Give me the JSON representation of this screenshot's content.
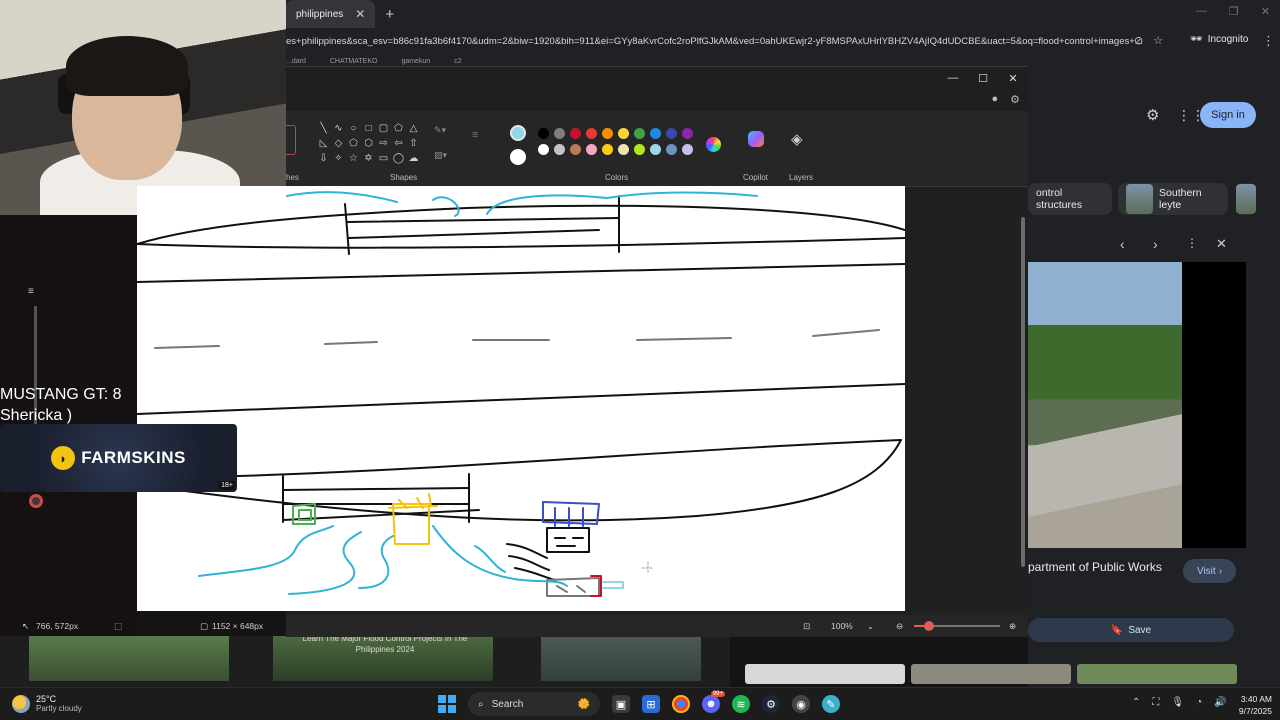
{
  "browser": {
    "tab_title": "philippines",
    "address": "es+philippines&sca_esv=b86c91fa3b6f4170&udm=2&biw=1920&bih=911&ei=GYy8aKvrCofc2roPlfGJkAM&ved=0ahUKEwjr2-yF8MSPAxUHrlYBHZV4AjIQ4dUDCBE&uact=5&oq=flood+control+images+...",
    "incognito_label": "Incognito",
    "bookmarks": [
      "...dard",
      "CHATMATEKO",
      "gamekun",
      "c2"
    ]
  },
  "google": {
    "signin": "Sign in",
    "chips": [
      "ontrol structures",
      "Southern leyte"
    ],
    "source": "partment of Public Works",
    "visit": "Visit",
    "save": "Save"
  },
  "stream": {
    "overlay_line1": "MUSTANG GT: 8",
    "overlay_line2": "Shericka )",
    "sponsor": "FARMSKINS",
    "sponsor_badge": "18+"
  },
  "paint": {
    "group_brushes": "hes",
    "group_shapes": "Shapes",
    "group_colors": "Colors",
    "group_copilot": "Copilot",
    "group_layers": "Layers",
    "cursor_pos": "766, 572px",
    "canvas_size": "1152 × 648px",
    "zoom": "100%",
    "active_color": "#8fd6e6",
    "palette_row1": [
      "#000000",
      "#7f7f7f",
      "#c8102e",
      "#e53935",
      "#fb8c00",
      "#fdd835",
      "#43a047",
      "#1e88e5",
      "#3949ab",
      "#8e24aa"
    ],
    "palette_row2": [
      "#ffffff",
      "#c3c3c3",
      "#b97a57",
      "#f8a5c2",
      "#ffc90e",
      "#efe4b0",
      "#b5e61d",
      "#99d9ea",
      "#7092be",
      "#c8bfe7"
    ]
  },
  "below": {
    "caption": "Learn The Major Flood Control Projects In The Philippines 2024"
  },
  "taskbar": {
    "temp": "25°C",
    "weather": "Partly cloudy",
    "search": "Search",
    "time": "3:40 AM",
    "date": "9/7/2025",
    "badge": "99+"
  }
}
